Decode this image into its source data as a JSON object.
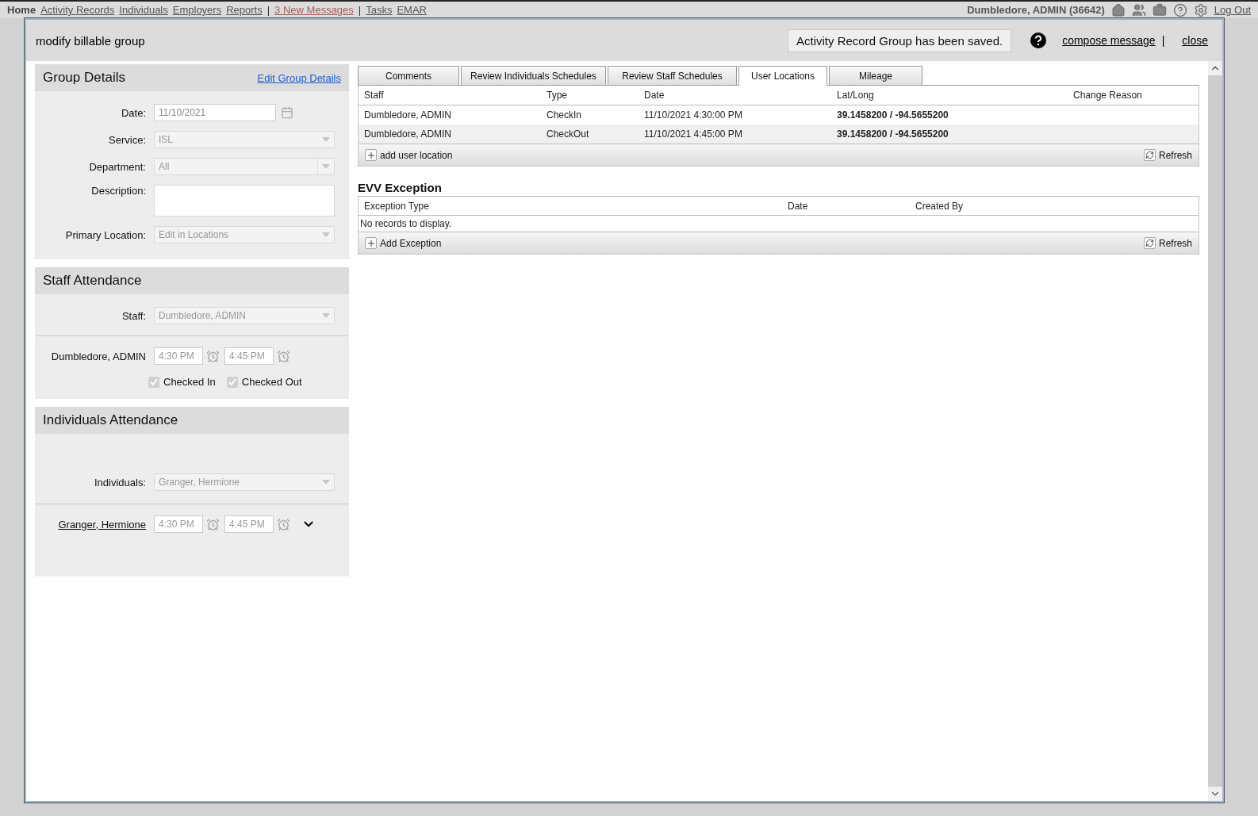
{
  "top_nav": {
    "items": [
      {
        "kind": "link",
        "label": "Home",
        "selected": true
      },
      {
        "kind": "link",
        "label": "Activity Records",
        "selected": false
      },
      {
        "kind": "link",
        "label": "Individuals",
        "selected": false
      },
      {
        "kind": "link",
        "label": "Employers",
        "selected": false
      },
      {
        "kind": "link",
        "label": "Reports",
        "selected": false
      },
      {
        "kind": "separator",
        "label": "|",
        "selected": false
      },
      {
        "kind": "alert",
        "label": "3 New Messages",
        "selected": false
      },
      {
        "kind": "separator",
        "label": "|",
        "selected": false
      },
      {
        "kind": "link",
        "label": "Tasks",
        "selected": false
      },
      {
        "kind": "link",
        "label": "EMAR",
        "selected": false
      }
    ],
    "user": "Dumbledore, ADMIN (36642)",
    "logout": "Log Out"
  },
  "dialog": {
    "title": "modify billable group",
    "status_message": "Activity Record Group has been saved.",
    "compose": "compose message",
    "separator": "|",
    "close": "close"
  },
  "group_details": {
    "title": "Group Details",
    "edit_link": "Edit Group Details",
    "fields": [
      {
        "kind": "date",
        "label": "Date:",
        "value": "11/10/2021"
      },
      {
        "kind": "select",
        "label": "Service:",
        "value": "ISL"
      },
      {
        "kind": "combo",
        "label": "Department:",
        "value": "All"
      },
      {
        "kind": "textarea",
        "label": "Description:"
      },
      {
        "kind": "select",
        "label": "Primary Location:",
        "value": "Edit in Locations"
      }
    ]
  },
  "staff_attendance": {
    "title": "Staff Attendance",
    "select_label": "Staff:",
    "select_value": "Dumbledore, ADMIN",
    "name": "Dumbledore, ADMIN",
    "start": "4:30 PM",
    "end": "4:45 PM",
    "checks": [
      {
        "label": "Checked In",
        "checked": true
      },
      {
        "label": "Checked Out",
        "checked": true
      }
    ]
  },
  "individuals_attendance": {
    "title": "Individuals Attendance",
    "select_label": "Individuals:",
    "select_value": "Granger, Hermione",
    "name": "Granger, Hermione",
    "start": "4:30 PM",
    "end": "4:45 PM"
  },
  "tabs": [
    {
      "label": "Comments",
      "selected": false
    },
    {
      "label": "Review Individuals Schedules",
      "selected": false
    },
    {
      "label": "Review Staff Schedules",
      "selected": false
    },
    {
      "label": "User Locations",
      "selected": true
    },
    {
      "label": "Mileage",
      "selected": false
    }
  ],
  "locations_table": {
    "columns": [
      "Staff",
      "Type",
      "Date",
      "Lat/Long",
      "Change Reason"
    ],
    "rows": [
      [
        "Dumbledore, ADMIN",
        "CheckIn",
        "11/10/2021 4:30:00 PM",
        "39.1458200 / -94.5655200"
      ],
      [
        "Dumbledore, ADMIN",
        "CheckOut",
        "11/10/2021 4:45:00 PM",
        "39.1458200 / -94.5655200"
      ]
    ],
    "add": "add user location",
    "refresh": "Refresh"
  },
  "evv_exception": {
    "title": "EVV Exception",
    "columns": [
      "Exception Type",
      "Date",
      "Created By"
    ],
    "empty": "No records to display.",
    "add": "Add Exception",
    "refresh": "Refresh"
  }
}
